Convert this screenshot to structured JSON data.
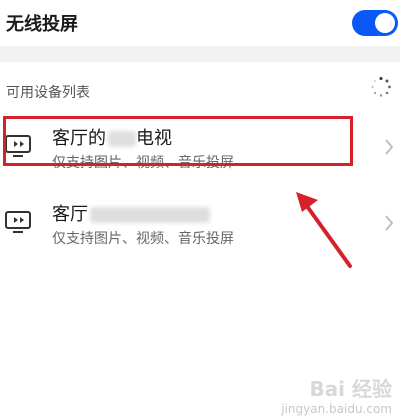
{
  "settings": {
    "wireless_projection": {
      "label": "无线投屏",
      "enabled": true
    }
  },
  "devices_section": {
    "label": "可用设备列表",
    "loading_icon": "spinner-icon"
  },
  "devices": [
    {
      "name_visible": "客厅的",
      "name_suffix": "电视",
      "name_partially_redacted": true,
      "capabilities": "仅支持图片、视频、音乐投屏",
      "icon": "tv-icon",
      "highlighted": true
    },
    {
      "name_visible": "客厅",
      "name_suffix": "",
      "name_partially_redacted": true,
      "capabilities": "仅支持图片、视频、音乐投屏",
      "icon": "tv-icon",
      "highlighted": false
    }
  ],
  "annotation": {
    "highlight_color": "#d6212b",
    "arrow_color": "#d6212b"
  },
  "colors": {
    "accent": "#0a59f7",
    "section_background": "#f2f2f2"
  },
  "watermark": {
    "main": "Bai 经验",
    "sub": "jingyan.baidu.com"
  }
}
